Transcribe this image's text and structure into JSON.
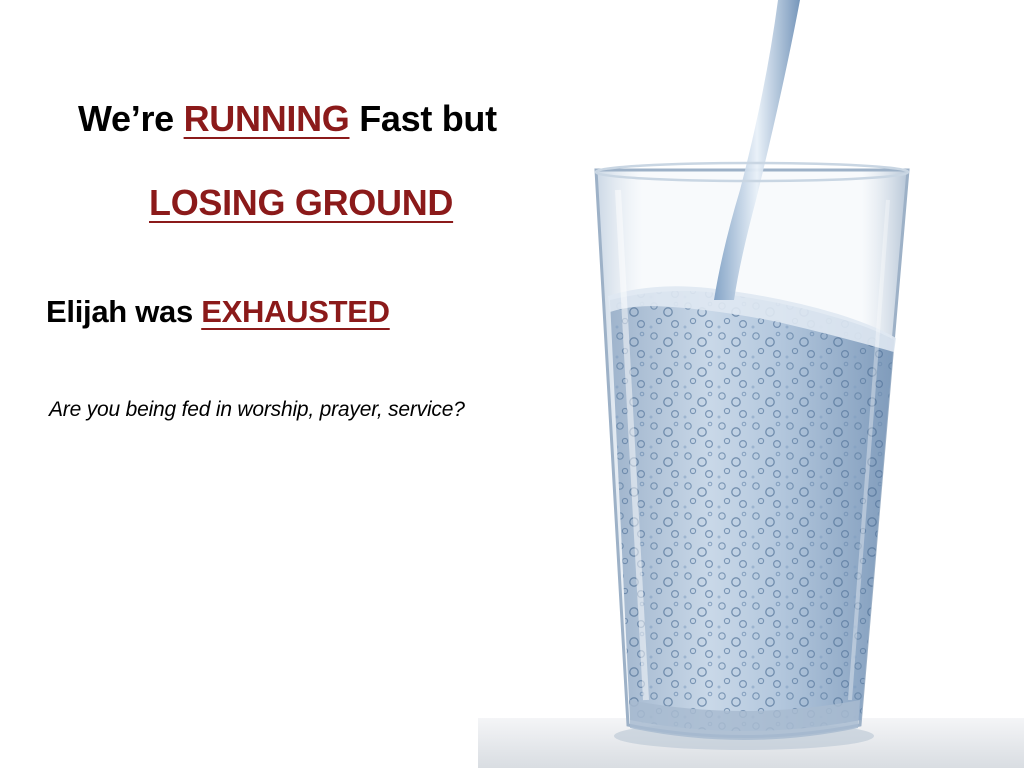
{
  "slide": {
    "headline": {
      "prefix": "We’re ",
      "emphasis": "RUNNING",
      "suffix": " Fast but"
    },
    "subheadline": "LOSING GROUND",
    "point": {
      "prefix": "Elijah was ",
      "emphasis": "EXHAUSTED"
    },
    "question": "Are you being fed in worship, prayer, service?"
  },
  "image": {
    "subject": "glass-of-water-icon"
  },
  "colors": {
    "accent": "#8b1a1a",
    "text": "#000000",
    "background": "#ffffff",
    "water": "#9fbad6"
  }
}
